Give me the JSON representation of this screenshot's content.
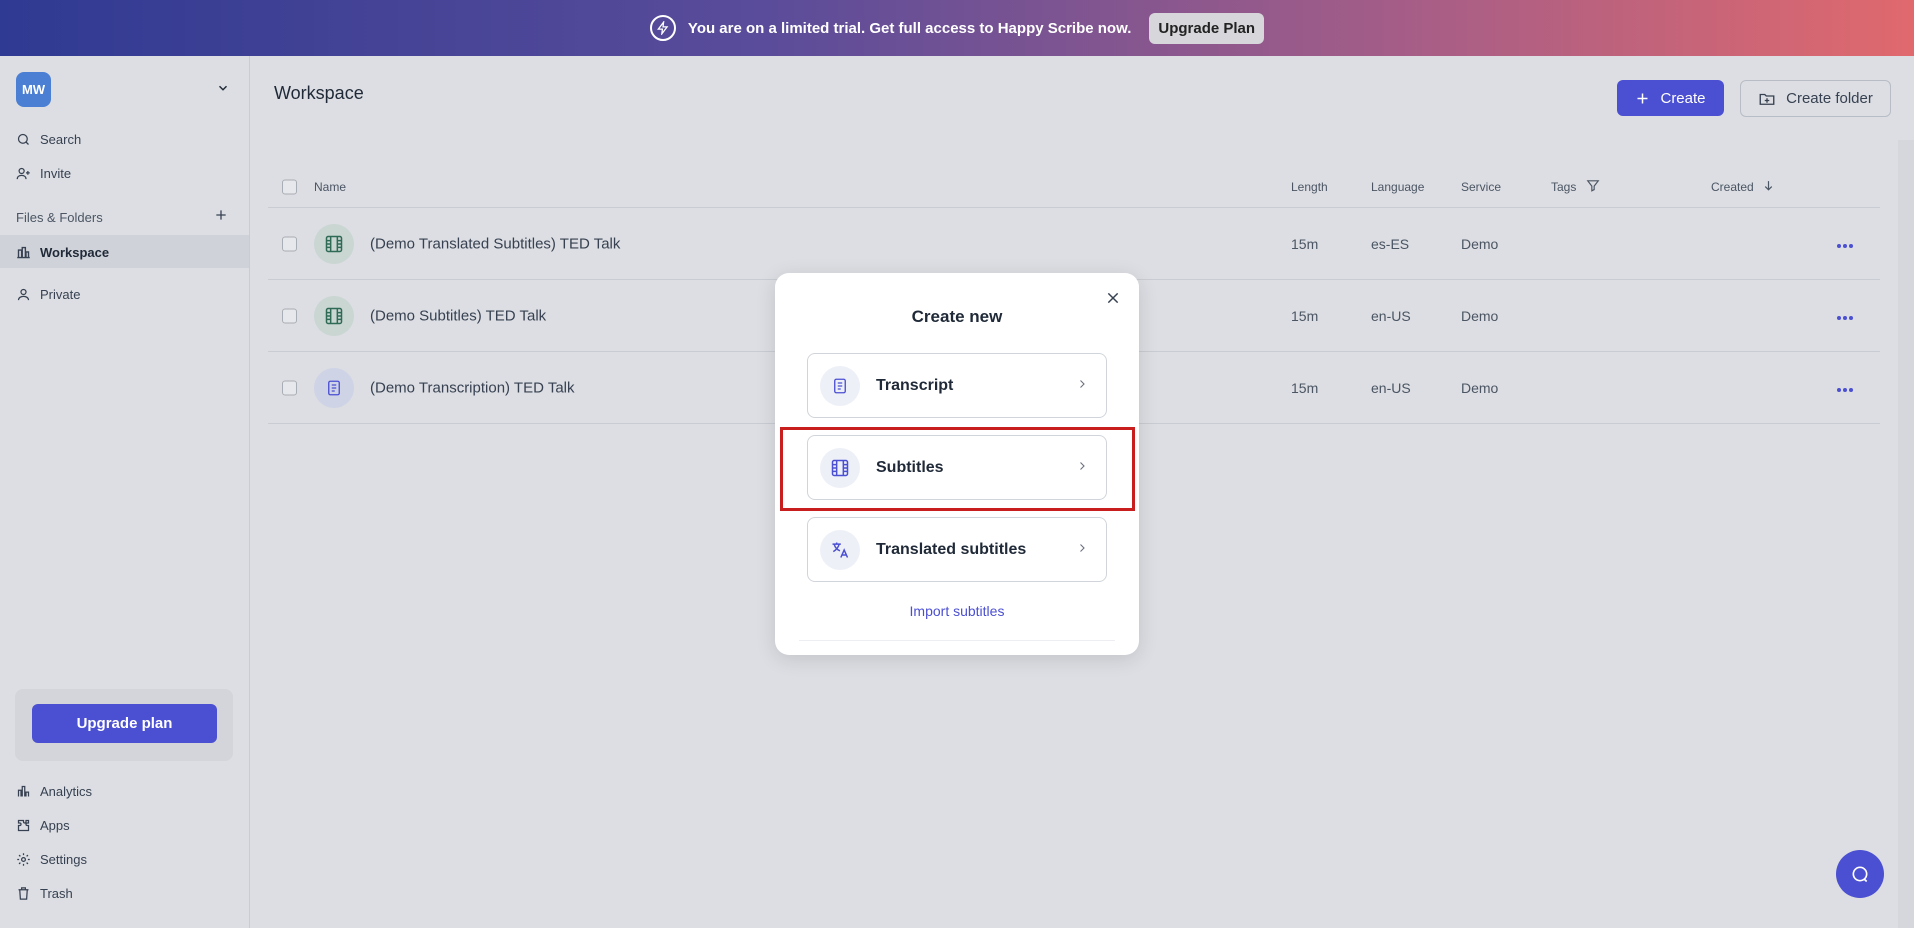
{
  "banner": {
    "message": "You are on a limited trial. Get full access to Happy Scribe now.",
    "upgrade_label": "Upgrade Plan"
  },
  "sidebar": {
    "avatar_initials": "MW",
    "search": "Search",
    "invite": "Invite",
    "section_label": "Files & Folders",
    "workspace": "Workspace",
    "private": "Private",
    "upgrade_button": "Upgrade plan",
    "analytics": "Analytics",
    "apps": "Apps",
    "settings": "Settings",
    "trash": "Trash"
  },
  "main": {
    "title": "Workspace",
    "create_label": "Create",
    "create_folder_label": "Create folder"
  },
  "table": {
    "columns": {
      "name": "Name",
      "length": "Length",
      "language": "Language",
      "service": "Service",
      "tags": "Tags",
      "created": "Created"
    },
    "rows": [
      {
        "name": "(Demo Translated Subtitles) TED Talk",
        "length": "15m",
        "language": "es-ES",
        "service": "Demo",
        "icon": "film-icon"
      },
      {
        "name": "(Demo Subtitles) TED Talk",
        "length": "15m",
        "language": "en-US",
        "service": "Demo",
        "icon": "film-icon"
      },
      {
        "name": "(Demo Transcription) TED Talk",
        "length": "15m",
        "language": "en-US",
        "service": "Demo",
        "icon": "document-icon"
      }
    ]
  },
  "modal": {
    "title": "Create new",
    "options": [
      {
        "label": "Transcript",
        "icon": "document-icon"
      },
      {
        "label": "Subtitles",
        "icon": "film-icon"
      },
      {
        "label": "Translated subtitles",
        "icon": "translate-icon"
      }
    ],
    "import_link": "Import subtitles"
  },
  "colors": {
    "accent": "#4b4fd1",
    "highlight": "#c81e1e"
  }
}
